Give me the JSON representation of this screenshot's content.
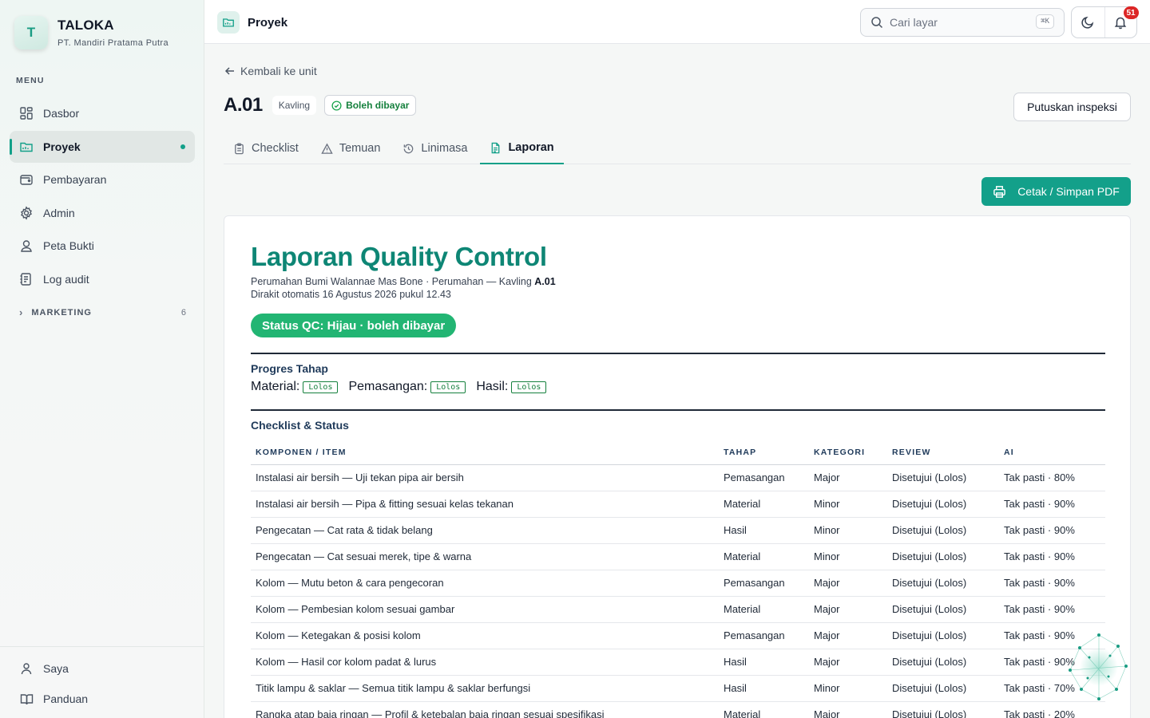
{
  "brand": {
    "initial": "T",
    "name": "TALOKA",
    "company": "PT. Mandiri Pratama Putra"
  },
  "sidebar": {
    "menu_label": "MENU",
    "items": [
      {
        "label": "Dasbor",
        "icon": "dashboard-icon"
      },
      {
        "label": "Proyek",
        "icon": "folder-icon",
        "active": true
      },
      {
        "label": "Pembayaran",
        "icon": "wallet-icon"
      },
      {
        "label": "Admin",
        "icon": "gear-icon"
      },
      {
        "label": "Peta Bukti",
        "icon": "map-pin-icon"
      },
      {
        "label": "Log audit",
        "icon": "log-icon"
      }
    ],
    "section": {
      "label": "MARKETING",
      "count": "6"
    },
    "bottom": [
      {
        "label": "Saya",
        "icon": "user-icon"
      },
      {
        "label": "Panduan",
        "icon": "book-icon"
      }
    ]
  },
  "topbar": {
    "title": "Proyek",
    "search_placeholder": "Cari layar",
    "shortcut": "⌘K",
    "notification_count": "51"
  },
  "page": {
    "back_label": "Kembali ke unit",
    "unit_title": "A.01",
    "unit_type": "Kavling",
    "pay_status": "Boleh dibayar",
    "decide_button": "Putuskan inspeksi",
    "tabs": [
      "Checklist",
      "Temuan",
      "Linimasa",
      "Laporan"
    ],
    "active_tab": "Laporan",
    "print_button": "Cetak / Simpan PDF"
  },
  "report": {
    "title": "Laporan Quality Control",
    "subtitle_prefix": "Perumahan Bumi Walannae Mas Bone · Perumahan — Kavling ",
    "subtitle_unit": "A.01",
    "generated": "Dirakit otomatis 16 Agustus 2026 pukul 12.43",
    "status": "Status QC: Hijau · boleh dibayar",
    "progress_heading": "Progres Tahap",
    "progress": [
      {
        "stage": "Material:",
        "result": "Lolos"
      },
      {
        "stage": "Pemasangan:",
        "result": "Lolos"
      },
      {
        "stage": "Hasil:",
        "result": "Lolos"
      }
    ],
    "checklist_heading": "Checklist & Status",
    "columns": [
      "KOMPONEN / ITEM",
      "TAHAP",
      "KATEGORI",
      "REVIEW",
      "AI"
    ],
    "rows": [
      [
        "Instalasi air bersih — Uji tekan pipa air bersih",
        "Pemasangan",
        "Major",
        "Disetujui (Lolos)",
        "Tak pasti · 80%"
      ],
      [
        "Instalasi air bersih — Pipa & fitting sesuai kelas tekanan",
        "Material",
        "Minor",
        "Disetujui (Lolos)",
        "Tak pasti · 90%"
      ],
      [
        "Pengecatan — Cat rata & tidak belang",
        "Hasil",
        "Minor",
        "Disetujui (Lolos)",
        "Tak pasti · 90%"
      ],
      [
        "Pengecatan — Cat sesuai merek, tipe & warna",
        "Material",
        "Minor",
        "Disetujui (Lolos)",
        "Tak pasti · 90%"
      ],
      [
        "Kolom — Mutu beton & cara pengecoran",
        "Pemasangan",
        "Major",
        "Disetujui (Lolos)",
        "Tak pasti · 90%"
      ],
      [
        "Kolom — Pembesian kolom sesuai gambar",
        "Material",
        "Major",
        "Disetujui (Lolos)",
        "Tak pasti · 90%"
      ],
      [
        "Kolom — Ketegakan & posisi kolom",
        "Pemasangan",
        "Major",
        "Disetujui (Lolos)",
        "Tak pasti · 90%"
      ],
      [
        "Kolom — Hasil cor kolom padat & lurus",
        "Hasil",
        "Major",
        "Disetujui (Lolos)",
        "Tak pasti · 90%"
      ],
      [
        "Titik lampu & saklar — Semua titik lampu & saklar berfungsi",
        "Hasil",
        "Minor",
        "Disetujui (Lolos)",
        "Tak pasti · 70%"
      ],
      [
        "Rangka atap baja ringan — Profil & ketebalan baja ringan sesuai spesifikasi",
        "Material",
        "Major",
        "Disetujui (Lolos)",
        "Tak pasti · 20%"
      ]
    ]
  },
  "colors": {
    "accent": "#13a08a",
    "status_green": "#22b573",
    "title_teal": "#0e8675"
  }
}
